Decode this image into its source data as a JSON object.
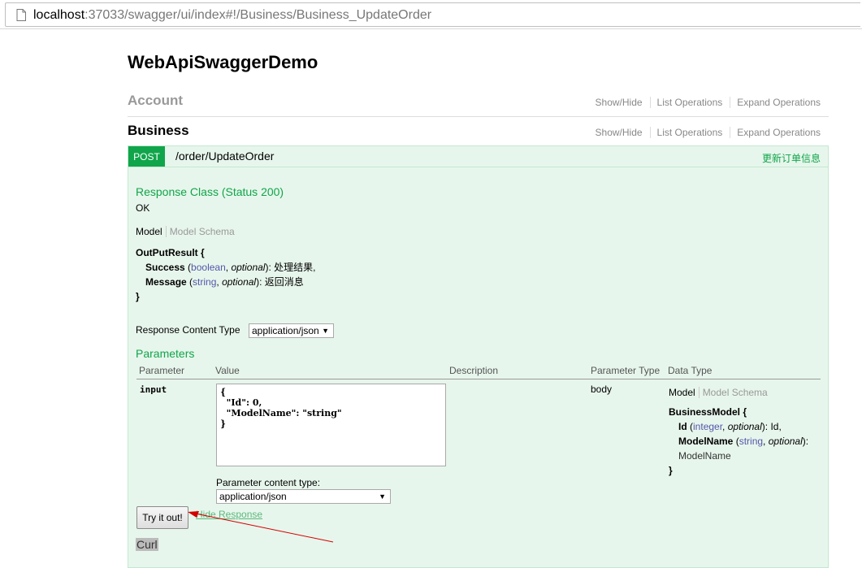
{
  "browser": {
    "url_host": "localhost",
    "url_rest": ":37033/swagger/ui/index#!/Business/Business_UpdateOrder",
    "page_icon": "page-icon"
  },
  "app": {
    "title": "WebApiSwaggerDemo"
  },
  "resources": [
    {
      "name": "Account",
      "show_hide": "Show/Hide",
      "list_ops": "List Operations",
      "expand_ops": "Expand Operations"
    },
    {
      "name": "Business",
      "show_hide": "Show/Hide",
      "list_ops": "List Operations",
      "expand_ops": "Expand Operations"
    }
  ],
  "operation": {
    "method": "POST",
    "path": "/order/UpdateOrder",
    "summary": "更新订单信息",
    "method_color": "#10a54a",
    "response_class_heading": "Response Class (Status 200)",
    "response_class_value": "OK",
    "model_tab": "Model",
    "schema_tab": "Model Schema",
    "response_model": {
      "name": "OutPutResult {",
      "fields": [
        {
          "name": "Success",
          "type": "boolean",
          "optional": "optional",
          "desc": "处理结果,"
        },
        {
          "name": "Message",
          "type": "string",
          "optional": "optional",
          "desc": "返回消息"
        }
      ],
      "close": "}"
    },
    "response_content_type_label": "Response Content Type",
    "response_content_type_value": "application/json",
    "parameters_heading": "Parameters",
    "param_columns": [
      "Parameter",
      "Value",
      "Description",
      "Parameter Type",
      "Data Type"
    ],
    "param": {
      "name": "input",
      "value": "{\n  \"Id\": 0,\n  \"ModelName\": \"string\"\n}",
      "param_type": "body",
      "content_type_label": "Parameter content type:",
      "content_type_value": "application/json",
      "model_tab": "Model",
      "schema_tab": "Model Schema",
      "model": {
        "name": "BusinessModel {",
        "fields": [
          {
            "name": "Id",
            "type": "integer",
            "optional": "optional",
            "desc": "Id,"
          },
          {
            "name": "ModelName",
            "type": "string",
            "optional": "optional",
            "desc": "ModelName"
          }
        ],
        "close": "}"
      }
    },
    "try_button": "Try it out!",
    "hide_response": "Hide Response",
    "curl_label": "Curl"
  },
  "annotation": {
    "arrow_color": "#d40000"
  }
}
